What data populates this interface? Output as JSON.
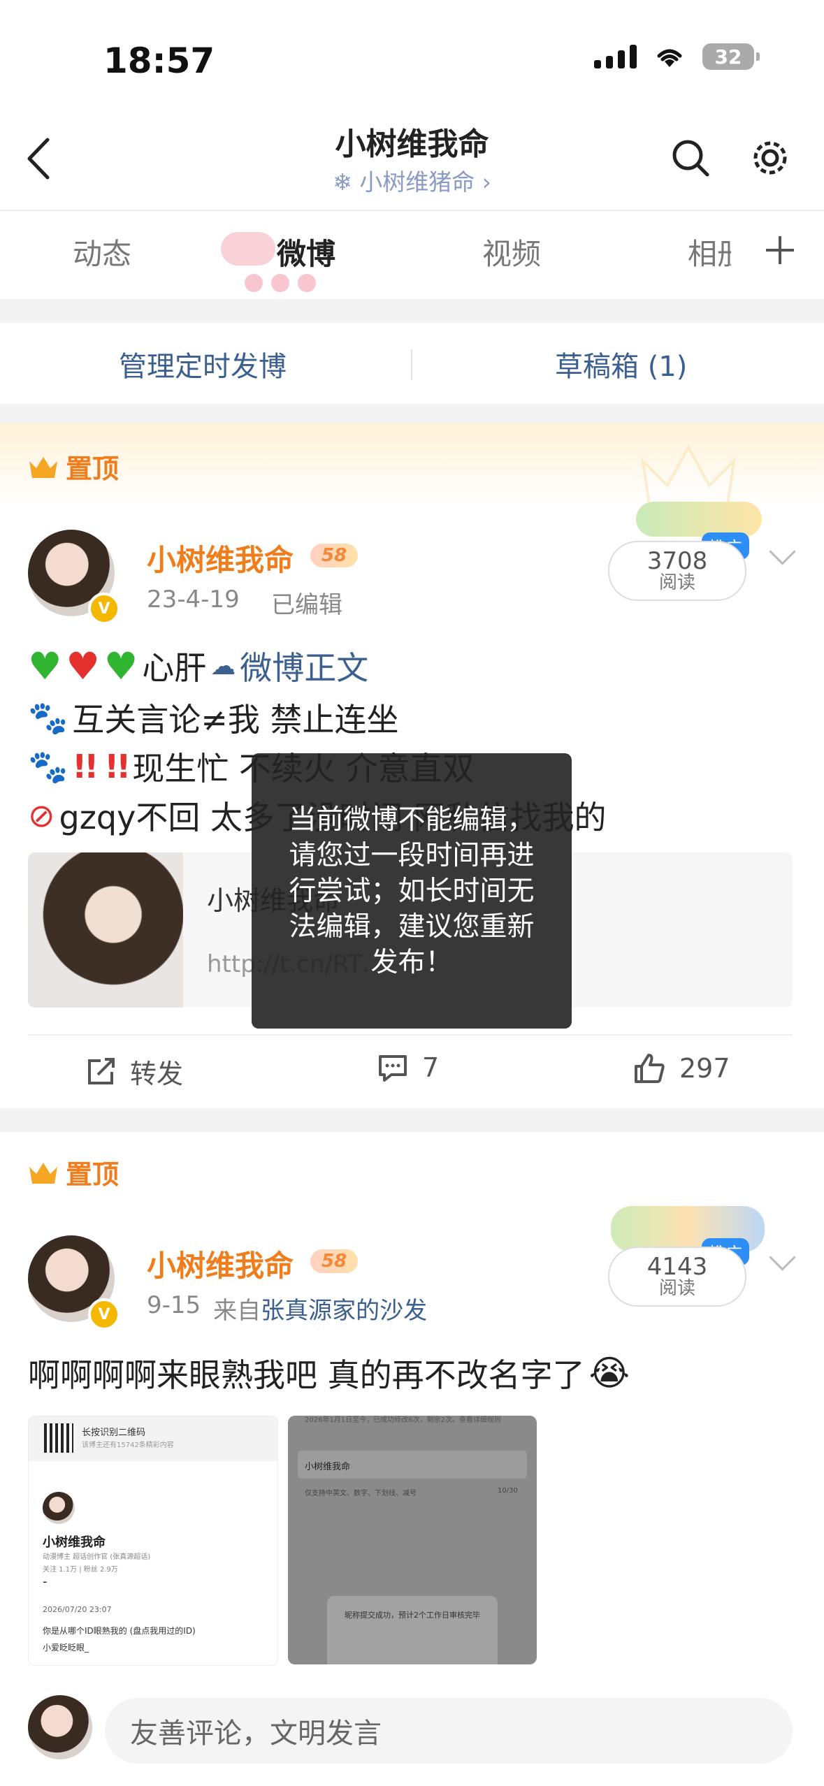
{
  "status": {
    "time": "18:57",
    "battery": "32"
  },
  "nav": {
    "title": "小树维我命",
    "subtitle": "❄ 小树维猪命 ›"
  },
  "tabs": [
    {
      "label": "动态"
    },
    {
      "label": "微博"
    },
    {
      "label": "视频"
    },
    {
      "label": "相册"
    }
  ],
  "schedule": {
    "manage": "管理定时发博",
    "drafts": "草稿箱 (1)"
  },
  "pinned_label": "置顶",
  "post1": {
    "username": "小树维我命",
    "level": "58",
    "date": "23-4-19",
    "edited": "已编辑",
    "read_count": "3708",
    "read_label": "阅读",
    "ad": "推广",
    "line1": "心肝",
    "line1_link": "微博正文",
    "line2": "互关言论≠我   禁止连坐",
    "line3": "现生忙 不续火 介意直双",
    "line4": "gzqy不回 太多了没时间 网私信找我的",
    "card_title": "小树维我命",
    "card_url": "http://t.cn/RT…",
    "repost": "转发",
    "comments": "7",
    "likes": "297"
  },
  "toast": "当前微博不能编辑，请您过一段时间再进行尝试；如长时间无法编辑，建议您重新发布！",
  "post2": {
    "username": "小树维我命",
    "level": "58",
    "date": "9-15",
    "source_prefix": "来自",
    "source": "张真源家的沙发",
    "read_count": "4143",
    "read_label": "阅读",
    "ad": "推广",
    "text": "啊啊啊啊来眼熟我吧 真的再不改名字了",
    "img1": {
      "qr_title": "长按识别二维码",
      "qr_sub": "该博主还有15742条精彩内容",
      "name": "小树维我命",
      "desc": "动漫博主 超话创作官 (张真源超话)",
      "stats": "关注 1.1万 | 粉丝 2.9万",
      "dash": "-",
      "date": "2026/07/20 23:07",
      "q": "你是从哪个ID眼熟我的 (盘点我用过的ID)",
      "a": "小爱眨眨眼_"
    },
    "img2": {
      "top": "2026年1月1日至今，已成功修改6次，剩余2次。查看详细规则",
      "field": "小树维我命",
      "hint": "仅支持中英文、数字、下划线、减号",
      "count": "10/30",
      "dialog": "昵称提交成功，预计2个工作日审核完毕"
    }
  },
  "comment": {
    "placeholder": "友善评论，文明发言"
  },
  "colors": {
    "accent": "#f07d1c",
    "link": "#3b5f8f",
    "ad": "#2d8ef5"
  }
}
